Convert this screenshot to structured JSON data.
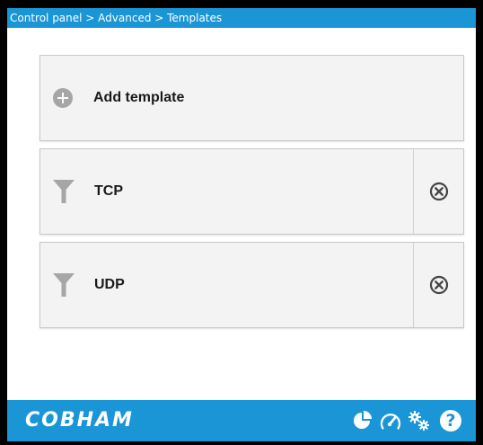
{
  "breadcrumb": "Control panel > Advanced > Templates",
  "add_template": {
    "label": "Add template",
    "icon": "add-circle-icon"
  },
  "templates": [
    {
      "name": "TCP",
      "icon": "filter-icon",
      "action_icon": "remove-circle-icon"
    },
    {
      "name": "UDP",
      "icon": "filter-icon",
      "action_icon": "remove-circle-icon"
    }
  ],
  "footer": {
    "brand": "COBHAM",
    "icons": [
      "pie-chart-icon",
      "gauge-icon",
      "settings-gears-icon",
      "help-icon"
    ],
    "help_glyph": "?"
  },
  "colors": {
    "accent": "#1a96d6",
    "panel_bg": "#f3f3f3",
    "icon_gray": "#a6a6a6",
    "border": "#c9c9c9"
  }
}
